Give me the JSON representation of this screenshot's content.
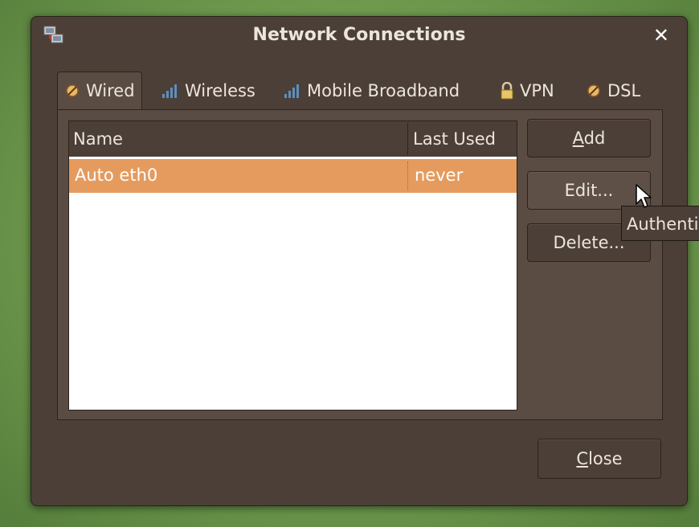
{
  "window": {
    "title": "Network Connections",
    "close_glyph": "✕"
  },
  "tabs": [
    {
      "label": "Wired",
      "icon": "wired-icon",
      "active": true
    },
    {
      "label": "Wireless",
      "icon": "wireless-signal-icon",
      "active": false
    },
    {
      "label": "Mobile Broadband",
      "icon": "mobile-signal-icon",
      "active": false
    },
    {
      "label": "VPN",
      "icon": "lock-icon",
      "active": false
    },
    {
      "label": "DSL",
      "icon": "dsl-icon",
      "active": false
    }
  ],
  "connections": {
    "columns": [
      "Name",
      "Last Used"
    ],
    "rows": [
      {
        "name": "Auto eth0",
        "last_used": "never",
        "selected": true
      }
    ]
  },
  "buttons": {
    "add": {
      "label": "Add",
      "mnemonic": "A",
      "rest": "dd"
    },
    "edit": {
      "label": "Edit..."
    },
    "delete": {
      "label": "Delete..."
    },
    "close": {
      "label": "Close",
      "mnemonic": "C",
      "rest": "lose"
    }
  },
  "tooltip": {
    "text": "Authenticate"
  },
  "colors": {
    "window_bg": "#4c3f37",
    "panel_bg": "#5a4c43",
    "selection": "#e59b5e",
    "text": "#ece5dc"
  }
}
